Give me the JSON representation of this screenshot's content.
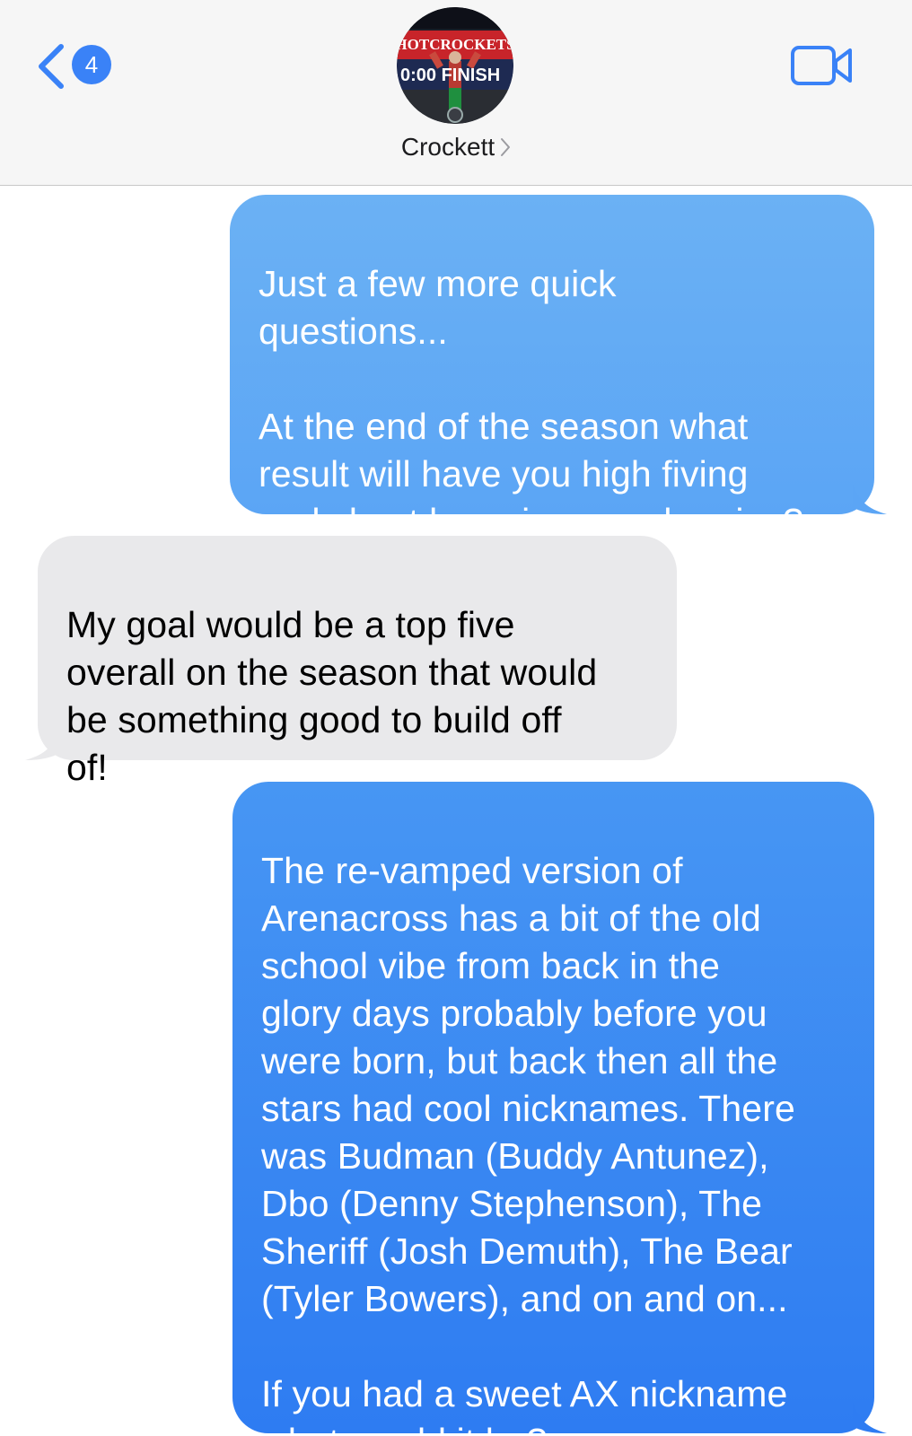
{
  "header": {
    "back_badge_count": "4",
    "contact_name": "Crockett",
    "avatar_text": {
      "line1": "HOTCROCKETS",
      "line2": "0:00 FINISH"
    }
  },
  "messages": [
    {
      "direction": "sent",
      "text": "Just a few more quick\nquestions...\n\nAt the end of the season what\nresult will have you high fiving\nand chest bumping your homies?"
    },
    {
      "direction": "received",
      "text": "My goal would be a top five\noverall on the season that would\nbe something good to build off\nof!"
    },
    {
      "direction": "sent",
      "text": "The re-vamped version of\nArenacross has a bit of the old\nschool vibe from back in the\nglory days probably before you\nwere born, but back then all the\nstars had cool nicknames. There\nwas Budman (Buddy Antunez),\nDbo (Denny Stephenson), The\nSheriff (Josh Demuth), The Bear\n(Tyler Bowers), and on and on...\n\nIf you had a sweet AX nickname\nwhat would it be?"
    }
  ],
  "colors": {
    "sent_bubble_top": "#6bb1f4",
    "sent_bubble_bottom": "#2e7cf2",
    "received_bubble": "#e9e9eb",
    "accent_blue": "#3a82f7",
    "header_bg": "#f6f6f6"
  },
  "icons": {
    "back": "chevron-left-icon",
    "video": "video-camera-icon",
    "contact_detail": "chevron-right-icon"
  }
}
